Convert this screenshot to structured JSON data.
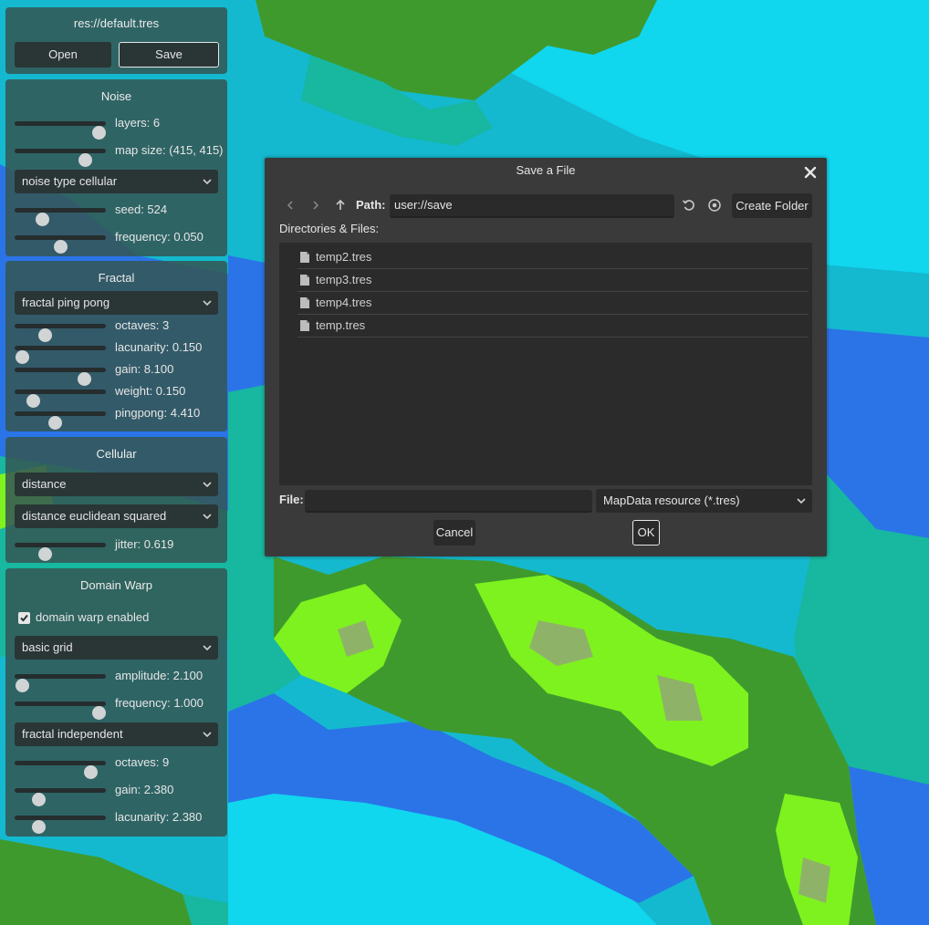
{
  "file_panel": {
    "title": "res://default.tres",
    "open_label": "Open",
    "save_label": "Save"
  },
  "noise": {
    "title": "Noise",
    "layers": {
      "label": "layers: 6",
      "value": 0.92
    },
    "map_size": {
      "label": "map size: (415, 415)",
      "value": 0.77
    },
    "noise_type": "noise type cellular",
    "seed": {
      "label": "seed: 524",
      "value": 0.3
    },
    "frequency": {
      "label": "frequency: 0.050",
      "value": 0.5
    }
  },
  "fractal": {
    "title": "Fractal",
    "fractal_type": "fractal ping pong",
    "octaves": {
      "label": "octaves: 3",
      "value": 0.33
    },
    "lacunarity": {
      "label": "lacunarity: 0.150",
      "value": 0.08
    },
    "gain": {
      "label": "gain: 8.100",
      "value": 0.76
    },
    "weight": {
      "label": "weight: 0.150",
      "value": 0.2
    },
    "pingpong": {
      "label": "pingpong: 4.410",
      "value": 0.44
    }
  },
  "cellular": {
    "title": "Cellular",
    "return_type": "distance",
    "distance_function": "distance euclidean squared",
    "jitter": {
      "label": "jitter: 0.619",
      "value": 0.33
    }
  },
  "domain_warp": {
    "title": "Domain Warp",
    "enabled_label": "domain warp enabled",
    "enabled": true,
    "type": "basic grid",
    "amplitude": {
      "label": "amplitude: 2.100",
      "value": 0.08
    },
    "frequency": {
      "label": "frequency: 1.000",
      "value": 0.92
    },
    "fractal_type": "fractal independent",
    "octaves": {
      "label": "octaves: 9",
      "value": 0.83
    },
    "gain": {
      "label": "gain: 2.380",
      "value": 0.26
    },
    "lacunarity": {
      "label": "lacunarity: 2.380",
      "value": 0.26
    }
  },
  "dialog": {
    "title": "Save a File",
    "path_label": "Path:",
    "path_value": "user://save",
    "create_folder_label": "Create Folder",
    "files_label": "Directories & Files:",
    "files": [
      "temp2.tres",
      "temp3.tres",
      "temp4.tres",
      "temp.tres"
    ],
    "file_label": "File:",
    "file_value": "",
    "filter": "MapData resource (*.tres)",
    "cancel_label": "Cancel",
    "ok_label": "OK"
  },
  "colors": {
    "deep_water": "#2a74e8",
    "water": "#14b9cf",
    "light_water": "#10d6ee",
    "sand": "#17b7a0",
    "grass": "#3f9a2e",
    "bright_grass": "#7ef21e",
    "hill": "#8fb269"
  },
  "icons": {
    "close": "close-icon",
    "back": "chevron-left-icon",
    "forward": "chevron-right-icon",
    "up": "arrow-up-icon",
    "refresh": "refresh-icon",
    "toggle_hidden": "eye-icon",
    "file": "file-icon",
    "dropdown": "chevron-down-icon",
    "checkbox": "checkmark-icon"
  }
}
